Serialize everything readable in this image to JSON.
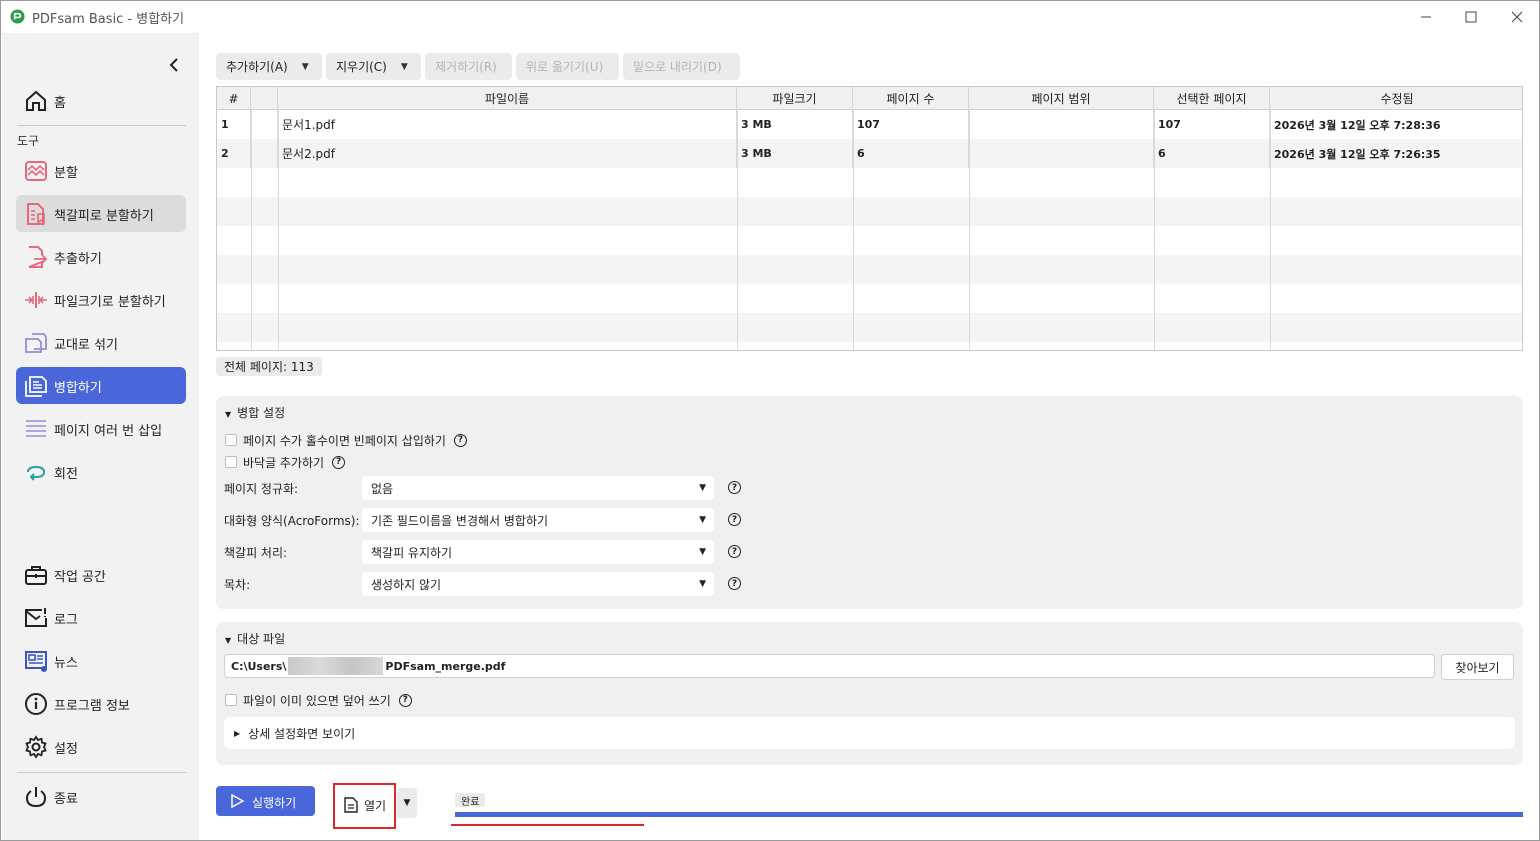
{
  "window": {
    "title": "PDFsam Basic - 병합하기",
    "controls": {
      "minimize": "–",
      "maximize": "☐",
      "close": "✕"
    }
  },
  "sidebar": {
    "home": "홈",
    "tools_label": "도구",
    "items": [
      {
        "label": "분할",
        "icon": "split-icon"
      },
      {
        "label": "책갈피로 분할하기",
        "icon": "split-by-bookmarks-icon"
      },
      {
        "label": "추출하기",
        "icon": "extract-icon"
      },
      {
        "label": "파일크기로 분할하기",
        "icon": "split-by-size-icon"
      },
      {
        "label": "교대로 섞기",
        "icon": "alternate-mix-icon"
      },
      {
        "label": "병합하기",
        "icon": "merge-icon"
      },
      {
        "label": "페이지 여러 번 삽입",
        "icon": "insert-pages-icon"
      },
      {
        "label": "회전",
        "icon": "rotate-icon"
      }
    ],
    "bottom": [
      {
        "label": "작업 공간",
        "icon": "workspace-icon"
      },
      {
        "label": "로그",
        "icon": "log-icon"
      },
      {
        "label": "뉴스",
        "icon": "news-icon"
      },
      {
        "label": "프로그램 정보",
        "icon": "info-icon"
      },
      {
        "label": "설정",
        "icon": "settings-icon"
      }
    ],
    "quit": "종료"
  },
  "toolbar": {
    "add": "추가하기(A)",
    "clear": "지우기(C)",
    "remove": "제거하기(R)",
    "move_up": "위로 옮기기(U)",
    "move_down": "밑으로 내리기(D)"
  },
  "table": {
    "columns": [
      "#",
      "",
      "파일이름",
      "파일크기",
      "페이지 수",
      "페이지 범위",
      "선택한 페이지",
      "수정됨"
    ],
    "rows": [
      {
        "num": "1",
        "name": "문서1.pdf",
        "size": "3 MB",
        "pages": "107",
        "range": "",
        "selected": "107",
        "modified": "2026년 3월 12일 오후 7:28:36"
      },
      {
        "num": "2",
        "name": "문서2.pdf",
        "size": "3 MB",
        "pages": "6",
        "range": "",
        "selected": "6",
        "modified": "2026년 3월 12일 오후 7:26:35"
      }
    ]
  },
  "total_pages": "전체 페이지: 113",
  "merge_settings": {
    "title": "병합 설정",
    "blank_page_checkbox": "페이지 수가 홀수이면 빈페이지 삽입하기",
    "footer_checkbox": "바닥글 추가하기",
    "normalize_label": "페이지 정규화:",
    "normalize_value": "없음",
    "acroforms_label": "대화형 양식(AcroForms):",
    "acroforms_value": "기존 필드이름을 변경해서 병합하기",
    "bookmarks_label": "책갈피 처리:",
    "bookmarks_value": "책갈피 유지하기",
    "toc_label": "목차:",
    "toc_value": "생성하지 않기"
  },
  "destination": {
    "title": "대상 파일",
    "path_prefix": "C:\\Users\\",
    "path_suffix": "PDFsam_merge.pdf",
    "browse": "찾아보기",
    "overwrite_checkbox": "파일이 이미 있으면 덮어 쓰기",
    "advanced": "상세 설정화면 보이기"
  },
  "footer": {
    "run": "실행하기",
    "open": "열기",
    "status": "완료",
    "progress": 1.0
  },
  "colors": {
    "accent": "#4a66db",
    "highlight": "#e0262b",
    "icon_pink": "#e26a7c"
  }
}
